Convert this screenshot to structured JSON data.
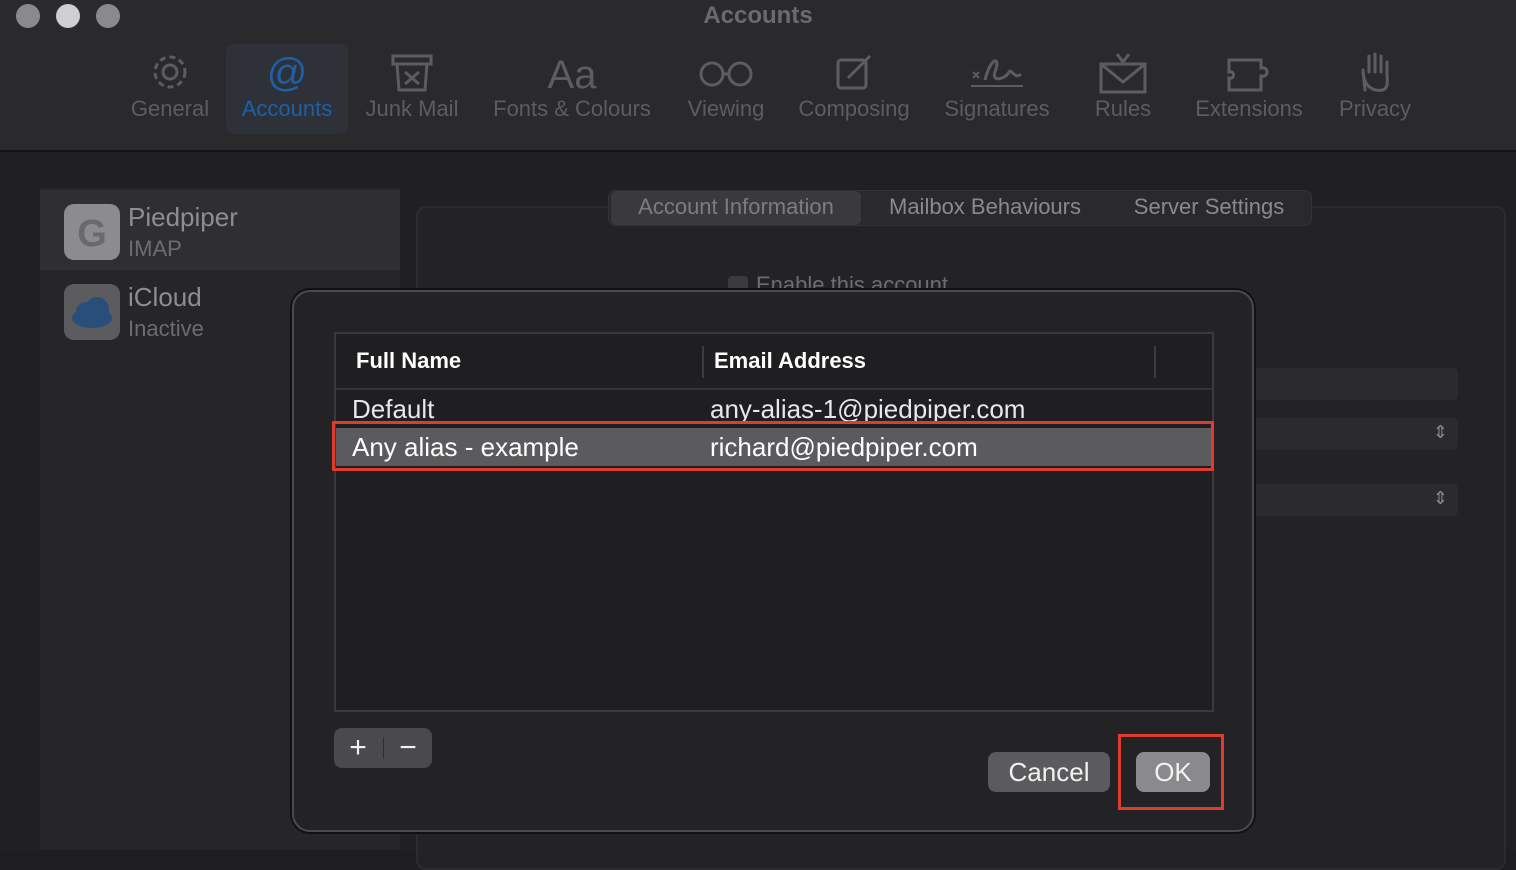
{
  "window": {
    "title": "Accounts"
  },
  "toolbar": {
    "items": [
      {
        "label": "General",
        "icon": "gear-icon"
      },
      {
        "label": "Accounts",
        "icon": "at-sign-icon"
      },
      {
        "label": "Junk Mail",
        "icon": "junk-bin-icon"
      },
      {
        "label": "Fonts & Colours",
        "icon": "font-aa-icon"
      },
      {
        "label": "Viewing",
        "icon": "glasses-icon"
      },
      {
        "label": "Composing",
        "icon": "compose-pencil-icon"
      },
      {
        "label": "Signatures",
        "icon": "signature-icon"
      },
      {
        "label": "Rules",
        "icon": "envelope-rules-icon"
      },
      {
        "label": "Extensions",
        "icon": "puzzle-piece-icon"
      },
      {
        "label": "Privacy",
        "icon": "hand-icon"
      }
    ]
  },
  "sidebar": {
    "accounts": [
      {
        "name": "Piedpiper",
        "type": "IMAP",
        "icon": "google-icon"
      },
      {
        "name": "iCloud",
        "type": "Inactive",
        "icon": "icloud-icon"
      }
    ]
  },
  "tabs": [
    "Account Information",
    "Mailbox Behaviours",
    "Server Settings"
  ],
  "background": {
    "enable_label": "Enable this account"
  },
  "dialog": {
    "columns": [
      "Full Name",
      "Email Address"
    ],
    "rows": [
      {
        "full_name": "Default",
        "email": "any-alias-1@piedpiper.com"
      },
      {
        "full_name": "Any alias - example",
        "email": "richard@piedpiper.com"
      }
    ],
    "add_label": "+",
    "remove_label": "−",
    "cancel_label": "Cancel",
    "ok_label": "OK"
  },
  "colors": {
    "highlight": "#e03c2e",
    "accent": "#1e5fa8"
  }
}
